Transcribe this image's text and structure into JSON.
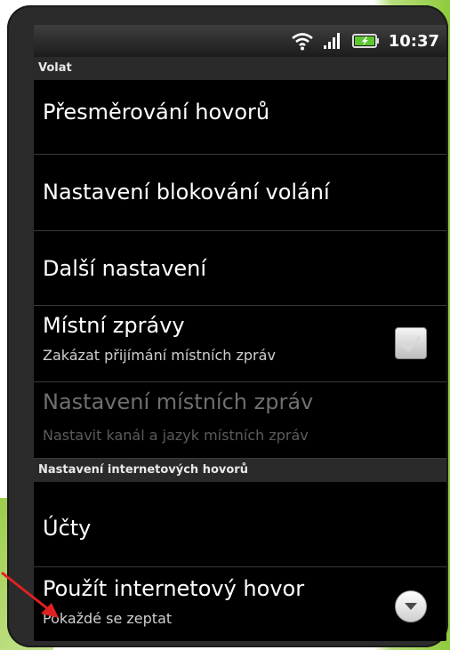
{
  "status_bar": {
    "time": "10:37",
    "icons": [
      "wifi-icon",
      "signal-icon",
      "battery-icon"
    ]
  },
  "sections": [
    {
      "header": "Volat"
    },
    {
      "header": "Nastavení internetových hovorů"
    }
  ],
  "rows": [
    {
      "title": "Přesměrování hovorů"
    },
    {
      "title": "Nastavení blokování volání"
    },
    {
      "title": "Další nastavení"
    },
    {
      "title": "Místní zprávy",
      "subtitle": "Zakázat přijímání místních zpráv",
      "checked": true
    },
    {
      "title": "Nastavení místních zpráv",
      "subtitle": "Nastavit kanál a jazyk místních zpráv",
      "enabled": false
    },
    {
      "title": "Účty"
    },
    {
      "title": "Použít internetový hovor",
      "subtitle": "Pokaždé se zeptat"
    }
  ],
  "colors": {
    "accent_green": "#8fcb3c",
    "annotation_arrow": "#e02020"
  }
}
